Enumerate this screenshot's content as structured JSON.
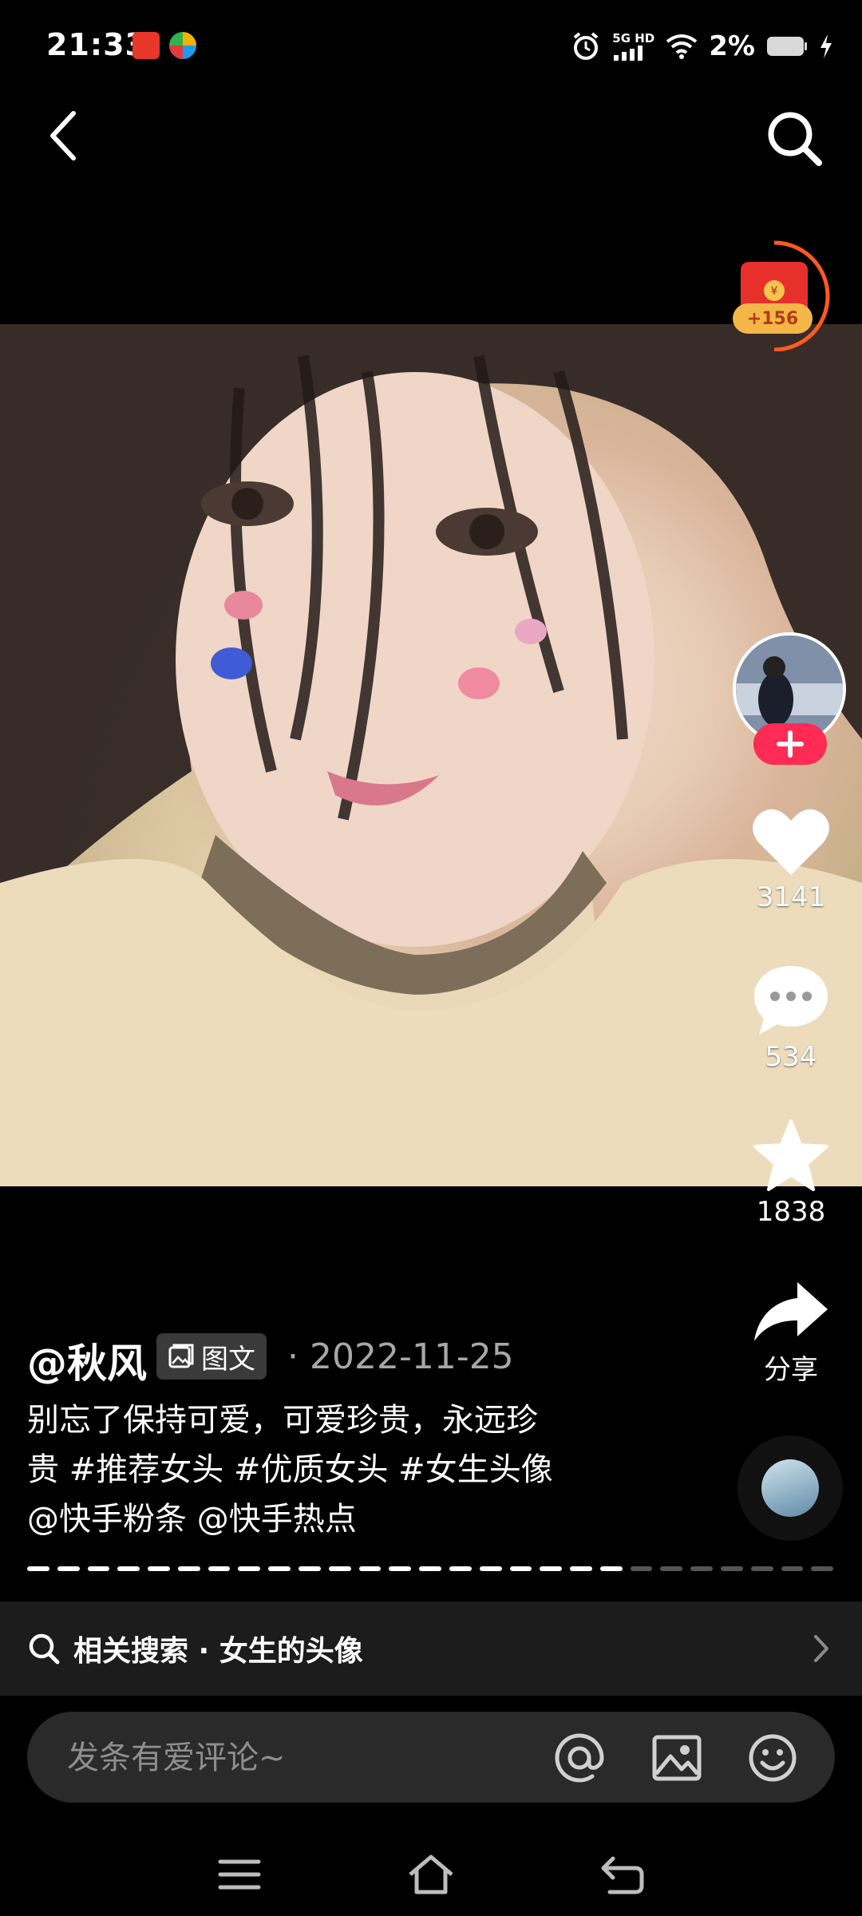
{
  "status_bar": {
    "time": "21:33",
    "network": "5G HD",
    "battery": "2%"
  },
  "post": {
    "author": "@秋风",
    "type_badge": "图文",
    "date": "· 2022-11-25",
    "caption_line1": "别忘了保持可爱，可爱珍贵，永远珍",
    "caption_line2": "贵 #推荐女头 #优质女头 #女生头像",
    "caption_line3": "@快手粉条 @快手热点"
  },
  "rail": {
    "reward_badge": "+156",
    "likes": "3141",
    "comments": "534",
    "favorites": "1838",
    "share_label": "分享"
  },
  "related_search": {
    "text": "相关搜索 · 女生的头像"
  },
  "comment": {
    "placeholder": "发条有爱评论~"
  },
  "colors": {
    "accent": "#fe2c55",
    "ring": "#ff5a1f",
    "background": "#000000"
  }
}
